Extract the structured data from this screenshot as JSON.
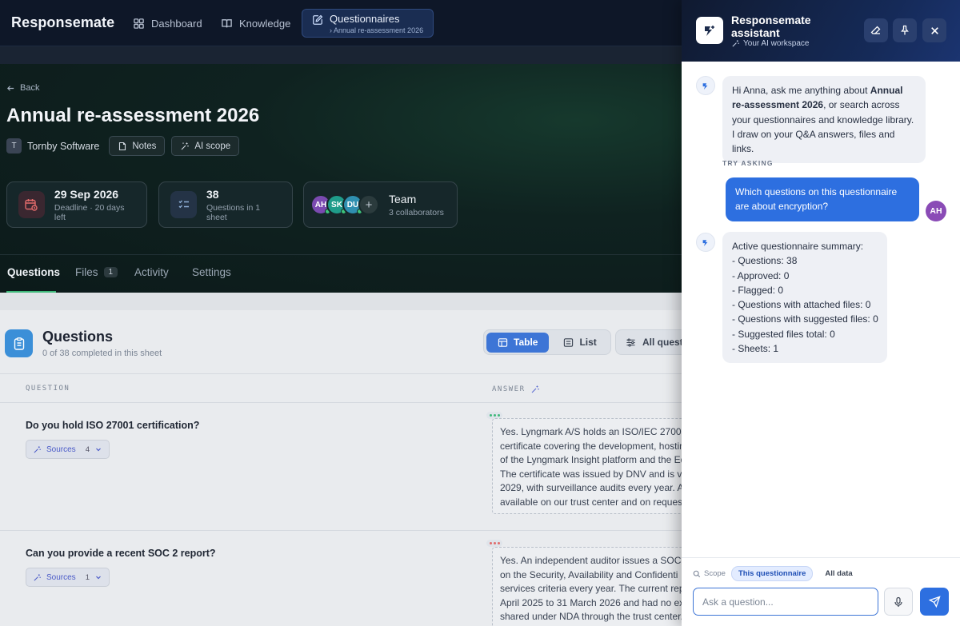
{
  "app": {
    "brand": "Responsemate"
  },
  "nav": {
    "dashboard": "Dashboard",
    "knowledge": "Knowledge",
    "questionnaires": "Questionnaires",
    "questionnaires_sub": "Annual re-assessment 2026"
  },
  "header": {
    "back": "Back",
    "title": "Annual re-assessment 2026",
    "company_initial": "T",
    "company": "Tornby Software",
    "notes": "Notes",
    "ai_scope": "AI scope"
  },
  "cards": {
    "deadline": {
      "value": "29 Sep 2026",
      "sub": "Deadline · 20 days left"
    },
    "questions": {
      "value": "38",
      "sub": "Questions in 1 sheet"
    },
    "team": {
      "value": "Team",
      "sub": "3 collaborators",
      "avatars": [
        {
          "initials": "AH",
          "color": "#7a4ab0"
        },
        {
          "initials": "SK",
          "color": "#1f9c8a"
        },
        {
          "initials": "DU",
          "color": "#2f8fb0"
        }
      ]
    }
  },
  "tabs": {
    "questions": "Questions",
    "files": "Files",
    "files_count": "1",
    "activity": "Activity",
    "settings": "Settings"
  },
  "questions_section": {
    "title": "Questions",
    "subtitle": "0 of 38 completed in this sheet",
    "view_table": "Table",
    "view_list": "List",
    "filter": "All questions",
    "col_question": "QUESTION",
    "col_answer": "ANSWER",
    "rows": [
      {
        "question": "Do you hold ISO 27001 certification?",
        "sources_label": "Sources",
        "sources_count": "4",
        "answer": "Yes. Lyngmark A/S holds an ISO/IEC 27001:\ncertificate covering the development, hostin\nof the Lyngmark Insight platform and the Ed\nThe certificate was issued by DNV and is va\n2029, with surveillance audits every year. A\navailable on our trust center and on request",
        "status_color": "#3fb97a"
      },
      {
        "question": "Can you provide a recent SOC 2 report?",
        "sources_label": "Sources",
        "sources_count": "1",
        "answer": "Yes. An independent auditor issues a SOC 2\non the Security, Availability and Confidenti\nservices criteria every year. The current repo\nApril 2025 to 31 March 2026 and had no exc\nshared under NDA through the trust center.",
        "status_color": "#e06a6a"
      }
    ]
  },
  "assistant": {
    "title": "Responsemate assistant",
    "subtitle": "Your AI workspace",
    "greeting_pre": "Hi Anna, ask me anything about ",
    "greeting_bold": "Annual re-assessment 2026",
    "greeting_post": ", or search across your questionnaires and knowledge library. I draw on your Q&A answers, files and links.",
    "try_asking": "TRY ASKING",
    "user_message": "Which questions on this questionnaire are about encryption?",
    "user_initials": "AH",
    "summary_lines": [
      "Active questionnaire summary:",
      "- Questions: 38",
      "- Approved: 0",
      "- Flagged: 0",
      "- Questions with attached files: 0",
      "- Questions with suggested files: 0",
      "- Suggested files total: 0",
      "- Sheets: 1"
    ],
    "scope_label": "Scope",
    "scope_this": "This questionnaire",
    "scope_all": "All data",
    "input_placeholder": "Ask a question..."
  },
  "colors": {
    "accent": "#2d6fe0",
    "success": "#3fb97a",
    "nav_bg": "#0e1728"
  }
}
